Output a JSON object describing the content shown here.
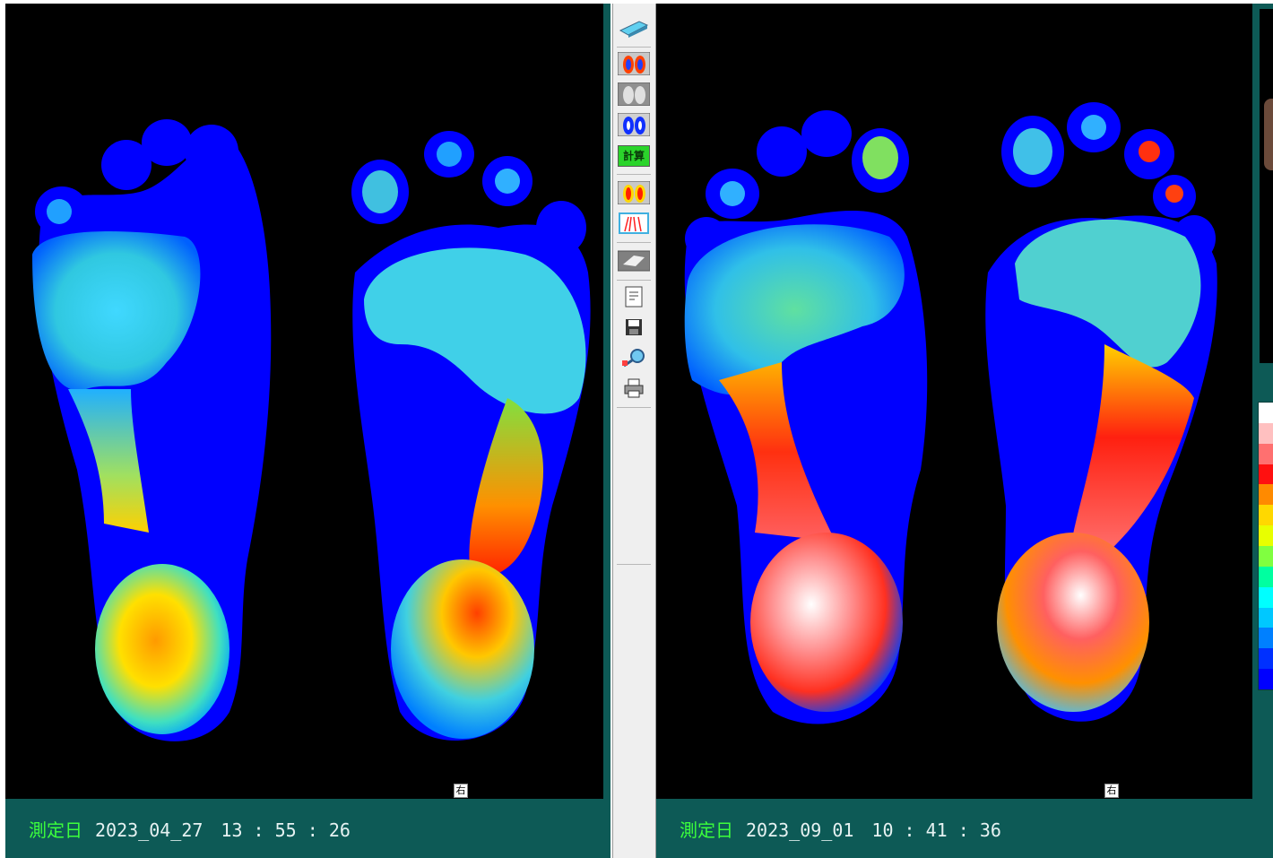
{
  "left_scan": {
    "date_label": "測定日",
    "date_value": "2023_04_27　13 : 55 : 26",
    "side_label": "右"
  },
  "right_scan": {
    "date_label": "測定日",
    "date_value": "2023_09_01　10 : 41 : 36",
    "side_label": "右"
  },
  "toolbar": {
    "calc_label": "計算",
    "icons": [
      "scanner-icon",
      "color-feet-icon",
      "gray-feet-icon",
      "blue-feet-icon",
      "calc-icon",
      "pressure-feet-icon",
      "foot-lines-icon",
      "eraser-icon",
      "report-icon",
      "save-icon",
      "zoom-icon",
      "print-icon"
    ]
  },
  "colors": {
    "panel_bg": "#0d5a56",
    "date_label": "#3cff3c",
    "foot_base": "#0000ff",
    "scale": [
      "#ffffff",
      "#ffc0c0",
      "#ff7070",
      "#ff1010",
      "#ff8a00",
      "#ffd800",
      "#e8ff00",
      "#80ff40",
      "#00ffa0",
      "#00ffff",
      "#00c8ff",
      "#0080ff",
      "#0030ff",
      "#0000ff"
    ]
  }
}
